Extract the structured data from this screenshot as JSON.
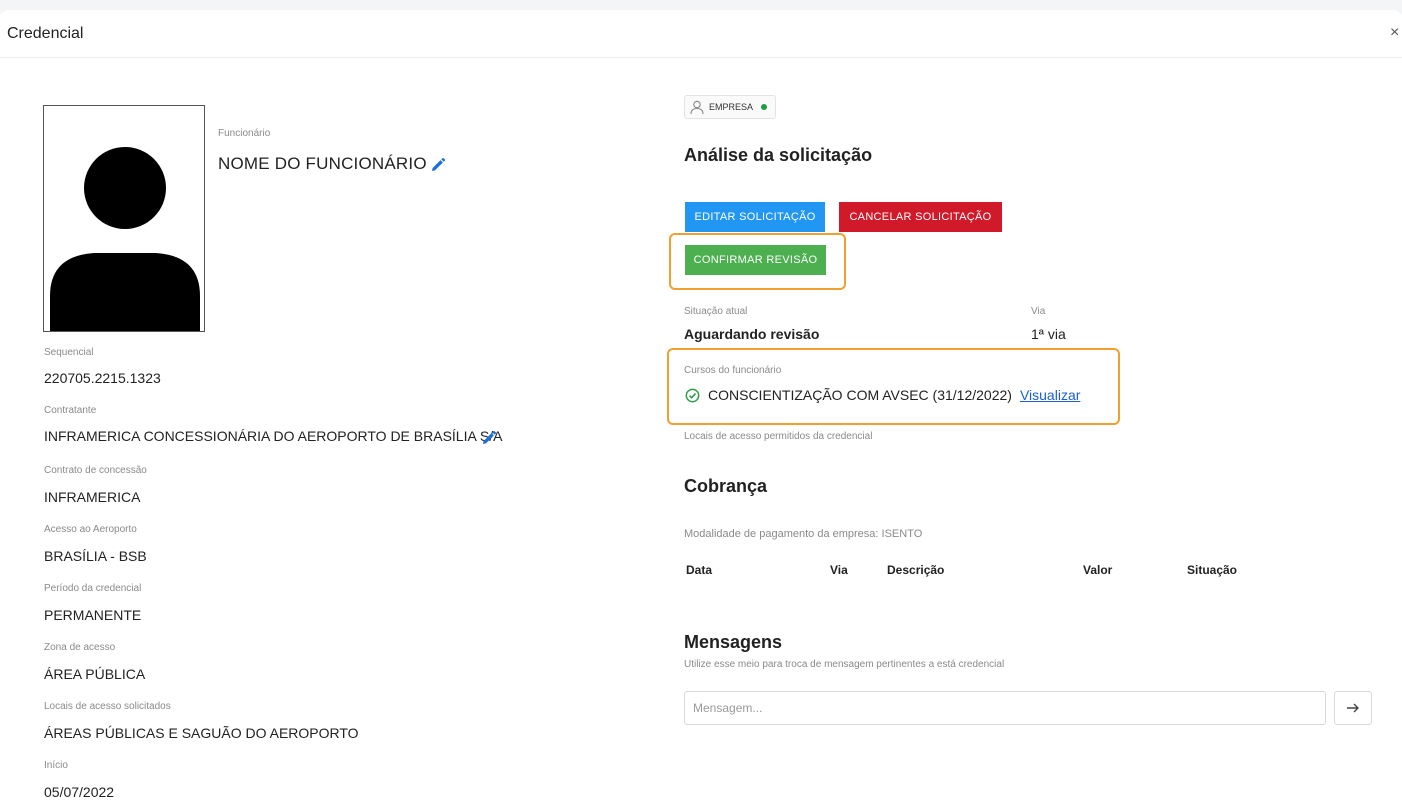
{
  "modal": {
    "title": "Credencial",
    "close_label": "×"
  },
  "employee": {
    "name_label": "Funcionário",
    "name": "NOME DO FUNCIONÁRIO"
  },
  "fields": [
    {
      "label": "Sequencial",
      "value": "220705.2215.1323"
    },
    {
      "label": "Contratante",
      "value": "INFRAMERICA CONCESSIONÁRIA DO AEROPORTO DE BRASÍLIA S/A"
    },
    {
      "label": "Contrato de concessão",
      "value": "INFRAMERICA"
    },
    {
      "label": "Acesso ao Aeroporto",
      "value": "BRASÍLIA - BSB"
    },
    {
      "label": "Período da credencial",
      "value": "PERMANENTE"
    },
    {
      "label": "Zona de acesso",
      "value": "ÁREA PÚBLICA"
    },
    {
      "label": "Locais de acesso solicitados",
      "value": "ÁREAS PÚBLICAS E SAGUÃO DO AEROPORTO"
    },
    {
      "label": "Início",
      "value": "05/07/2022"
    }
  ],
  "badge": {
    "text": "EMPRESA",
    "status_color": "#1e9e3e"
  },
  "analysis": {
    "title": "Análise da solicitação",
    "edit_button": "EDITAR SOLICITAÇÃO",
    "cancel_button": "CANCELAR SOLICITAÇÃO",
    "confirm_button": "CONFIRMAR REVISÃO",
    "status_label": "Situação atual",
    "status_value": "Aguardando revisão",
    "via_label": "Via",
    "via_value": "1ª via",
    "courses_label": "Cursos do funcionário",
    "course_text": "CONSCIENTIZAÇÃO COM AVSEC (31/12/2022)",
    "course_link": "Visualizar",
    "locations_label": "Locais de acesso permitidos da credencial"
  },
  "billing": {
    "title": "Cobrança",
    "payment_mode": "Modalidade de pagamento da empresa: ISENTO",
    "columns": [
      "Data",
      "Via",
      "Descrição",
      "Valor",
      "Situação"
    ]
  },
  "messages": {
    "title": "Mensagens",
    "subtitle": "Utilize esse meio para troca de mensagem pertinentes a está credencial",
    "input_placeholder": "Mensagem..."
  },
  "colors": {
    "edit_button": "#2196f3",
    "cancel_button": "#d01a2a",
    "confirm_button": "#4caf50",
    "highlight": "#f0a030",
    "link": "#1a5fd0"
  }
}
